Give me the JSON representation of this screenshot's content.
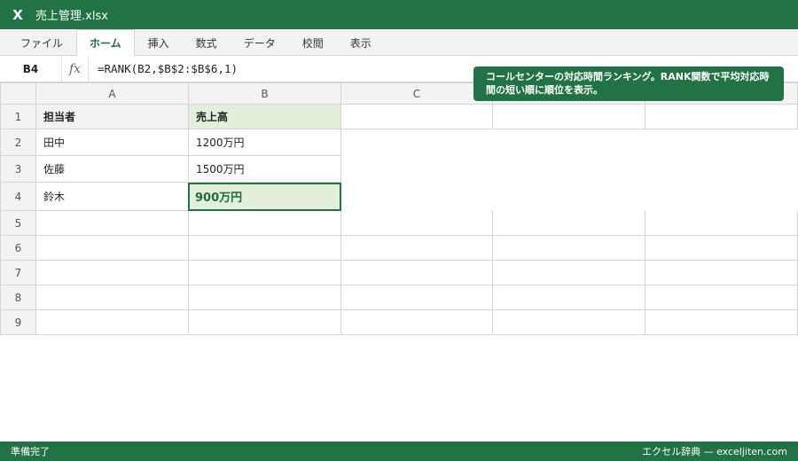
{
  "window": {
    "icon_glyph": "X",
    "title": "売上管理.xlsx"
  },
  "ribbon": {
    "tabs": [
      "ファイル",
      "ホーム",
      "挿入",
      "数式",
      "データ",
      "校閲",
      "表示"
    ]
  },
  "formula_bar": {
    "cell_ref": "B4",
    "fx_label": "fx",
    "formula": "=RANK(B2,$B$2:$B$6,1)"
  },
  "callout": {
    "text": "コールセンターの対応時間ランキング。RANK関数で平均対応時間の短い順に順位を表示。"
  },
  "sheet": {
    "columns": [
      "A",
      "B",
      "C",
      "",
      ""
    ],
    "rows": [
      "1",
      "2",
      "3",
      "4",
      "5",
      "6",
      "7",
      "8",
      "9"
    ],
    "cells": {
      "A1": "担当者",
      "B1": "売上高",
      "A2": "田中",
      "B2": "1200万円",
      "A3": "佐藤",
      "B3": "1500万円",
      "A4": "鈴木",
      "B4": "900万円"
    },
    "selected_cell": "B4"
  },
  "status": {
    "left": "準備完了",
    "right": "エクセル辞典 — exceljiten.com"
  },
  "colors": {
    "accent": "#217346",
    "header_fill": "#e2efda"
  }
}
